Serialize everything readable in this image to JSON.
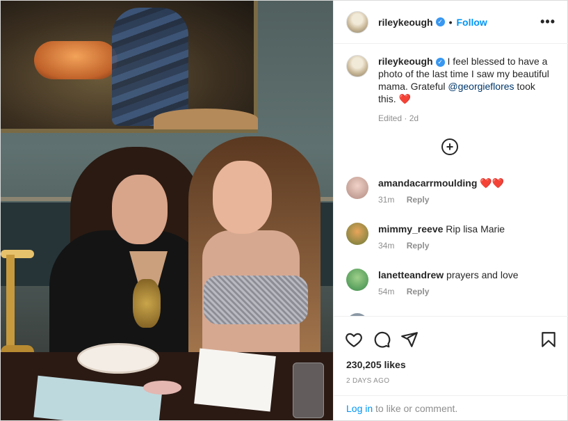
{
  "post": {
    "author": "rileykeough",
    "follow_label": "Follow",
    "separator": "•",
    "more_label": "•••"
  },
  "caption": {
    "username": "rileykeough",
    "text_before": "I feel blessed to have a photo of the last time I saw my beautiful mama. Grateful",
    "mention": "@georgieflores",
    "text_after": "took this.",
    "emoji": "❤️",
    "edited": "Edited",
    "time": "2d"
  },
  "comments": [
    {
      "username": "amandacarrmoulding",
      "text": "❤️❤️",
      "time": "31m",
      "reply": "Reply"
    },
    {
      "username": "mimmy_reeve",
      "text": "Rip lisa Marie",
      "time": "34m",
      "reply": "Reply"
    },
    {
      "username": "lanetteandrew",
      "text": "prayers and love",
      "time": "54m",
      "reply": "Reply"
    }
  ],
  "likes": "230,205 likes",
  "date": "2 DAYS AGO",
  "login": {
    "link": "Log in",
    "rest": "to like or comment."
  },
  "icons": [
    "heart-icon",
    "comment-icon",
    "share-icon",
    "bookmark-icon",
    "add-icon",
    "more-icon"
  ],
  "colors": {
    "link": "#0095f6",
    "verified": "#3897f0",
    "heart": "#ed4956",
    "muted": "#8e8e8e"
  }
}
